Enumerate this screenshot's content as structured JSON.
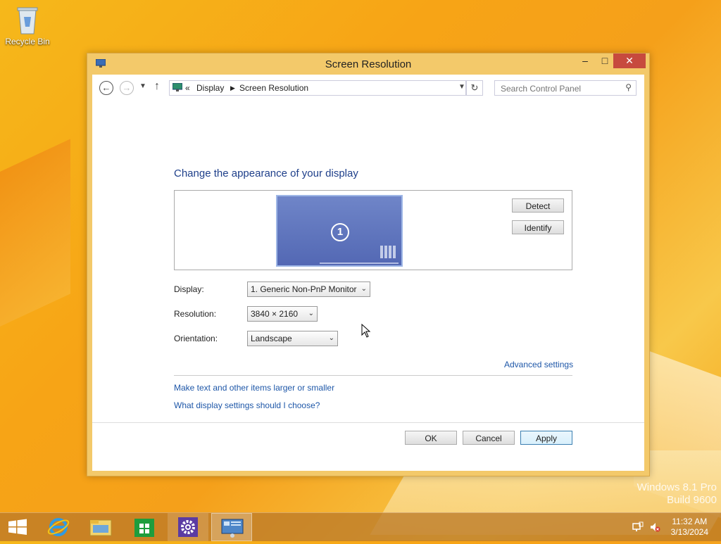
{
  "desktop": {
    "recycle_bin_label": "Recycle Bin",
    "watermark_line1": "Windows 8.1 Pro",
    "watermark_line2": "Build 9600"
  },
  "window": {
    "title": "Screen Resolution",
    "icon": "display-control-panel-icon"
  },
  "address_bar": {
    "overflow": "«",
    "crumbs": [
      "Display",
      "Screen Resolution"
    ],
    "search_placeholder": "Search Control Panel"
  },
  "content": {
    "heading": "Change the appearance of your display",
    "monitor_number": "1",
    "detect_label": "Detect",
    "identify_label": "Identify",
    "display_label": "Display:",
    "display_value": "1. Generic Non-PnP Monitor",
    "resolution_label": "Resolution:",
    "resolution_value": "3840 × 2160",
    "orientation_label": "Orientation:",
    "orientation_value": "Landscape",
    "advanced_link": "Advanced settings",
    "link_text_size": "Make text and other items larger or smaller",
    "link_display_help": "What display settings should I choose?"
  },
  "footer": {
    "ok_label": "OK",
    "cancel_label": "Cancel",
    "apply_label": "Apply"
  },
  "taskbar": {
    "items": [
      "start-icon",
      "internet-explorer-icon",
      "file-explorer-icon",
      "store-icon",
      "settings-icon",
      "screen-resolution-icon"
    ],
    "time": "11:32 AM",
    "date": "3/13/2024"
  },
  "colors": {
    "accent_blue": "#1e3f8a",
    "link_blue": "#1e57a8",
    "close_red": "#c74a3e",
    "desktop_orange": "#f7a416"
  }
}
